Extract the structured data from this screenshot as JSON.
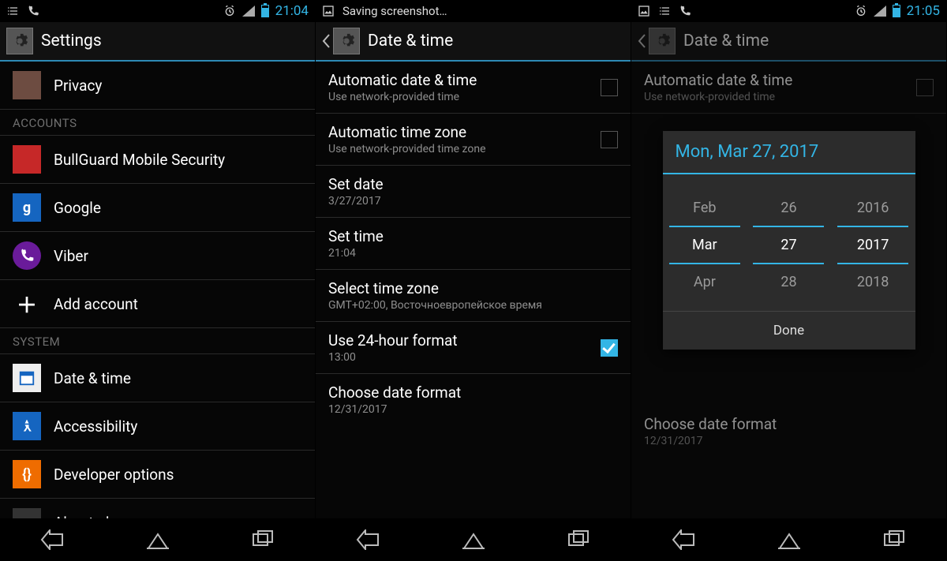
{
  "panels": [
    {
      "status": {
        "time": "21:04",
        "saving": ""
      },
      "actionbar": {
        "title": "Settings"
      },
      "settings": {
        "items": [
          {
            "icon": "bg-brown",
            "title": "Privacy"
          }
        ],
        "accounts_header": "ACCOUNTS",
        "accounts": [
          {
            "icon": "bg-red",
            "title": "BullGuard Mobile Security"
          },
          {
            "icon": "bg-blue",
            "glyph": "g",
            "title": "Google"
          },
          {
            "icon": "bg-violet",
            "title": "Viber"
          },
          {
            "icon": "plus",
            "title": "Add account"
          }
        ],
        "system_header": "SYSTEM",
        "system": [
          {
            "icon": "bg-white",
            "title": "Date & time"
          },
          {
            "icon": "bg-blue",
            "title": "Accessibility"
          },
          {
            "icon": "bg-orange",
            "glyph": "{}",
            "title": "Developer options"
          },
          {
            "icon": "bg-dark",
            "title": "About phone"
          }
        ]
      }
    },
    {
      "status": {
        "time": "",
        "saving": "Saving screenshot…"
      },
      "actionbar": {
        "title": "Date & time"
      },
      "dt": {
        "auto_date": {
          "title": "Automatic date & time",
          "sub": "Use network-provided time",
          "checked": false
        },
        "auto_tz": {
          "title": "Automatic time zone",
          "sub": "Use network-provided time zone",
          "checked": false
        },
        "set_date": {
          "title": "Set date",
          "sub": "3/27/2017"
        },
        "set_time": {
          "title": "Set time",
          "sub": "21:04"
        },
        "tz": {
          "title": "Select time zone",
          "sub": "GMT+02:00, Восточноевропейское время"
        },
        "h24": {
          "title": "Use 24-hour format",
          "sub": "13:00",
          "checked": true
        },
        "fmt": {
          "title": "Choose date format",
          "sub": "12/31/2017"
        }
      }
    },
    {
      "status": {
        "time": "21:05"
      },
      "actionbar": {
        "title": "Date & time"
      },
      "dt": {
        "auto_date": {
          "title": "Automatic date & time",
          "sub": "Use network-provided time"
        },
        "fmt": {
          "title": "Choose date format",
          "sub": "12/31/2017"
        }
      },
      "dialog": {
        "header": "Mon, Mar 27, 2017",
        "cols": [
          {
            "prev": "Feb",
            "sel": "Mar",
            "next": "Apr"
          },
          {
            "prev": "26",
            "sel": "27",
            "next": "28"
          },
          {
            "prev": "2016",
            "sel": "2017",
            "next": "2018"
          }
        ],
        "done": "Done"
      }
    }
  ]
}
